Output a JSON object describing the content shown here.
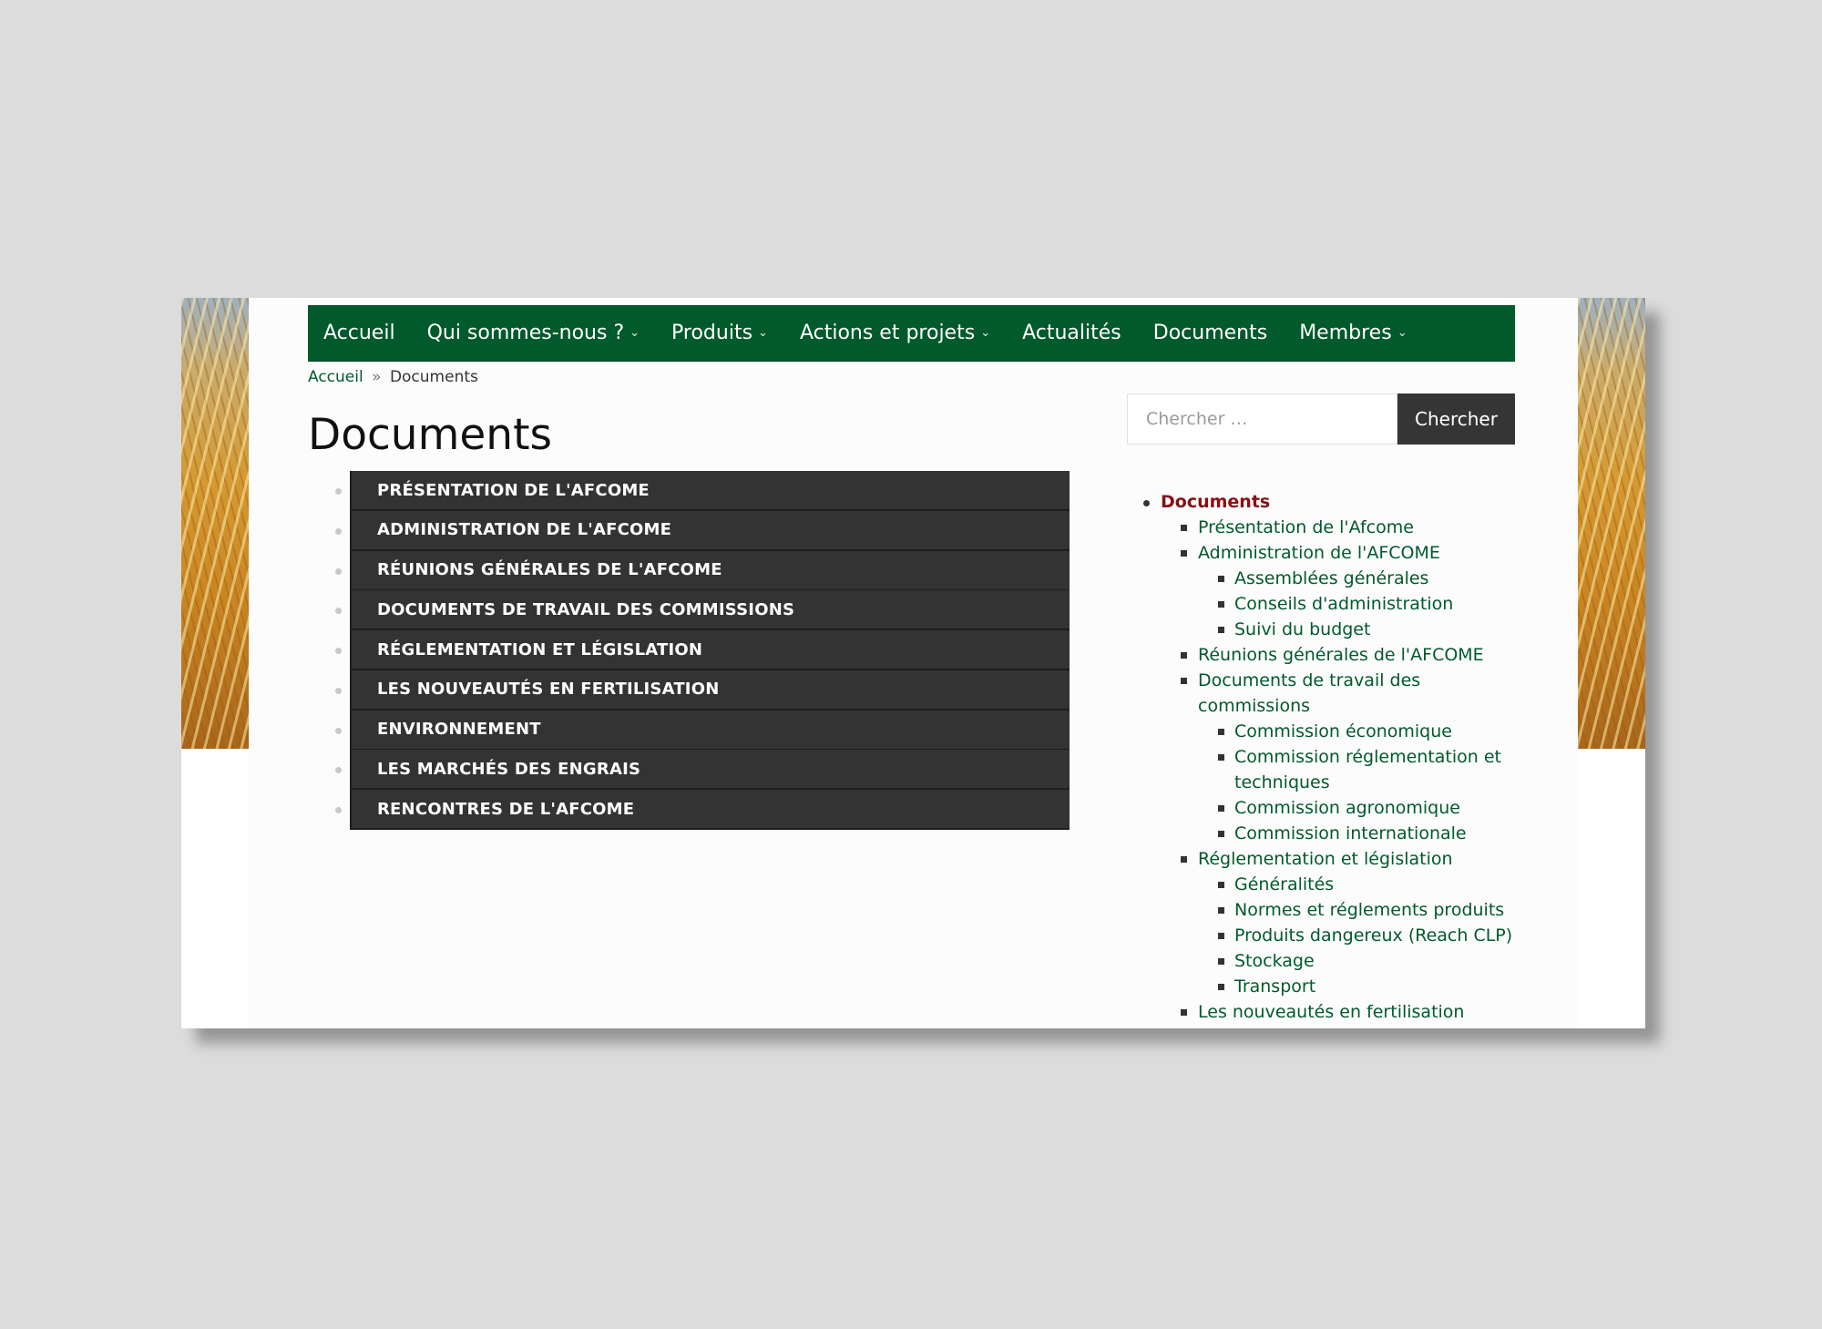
{
  "nav": {
    "items": [
      {
        "label": "Accueil",
        "has_submenu": false
      },
      {
        "label": "Qui sommes-nous ?",
        "has_submenu": true
      },
      {
        "label": "Produits",
        "has_submenu": true
      },
      {
        "label": "Actions et projets",
        "has_submenu": true
      },
      {
        "label": "Actualités",
        "has_submenu": false
      },
      {
        "label": "Documents",
        "has_submenu": false
      },
      {
        "label": "Membres",
        "has_submenu": true
      }
    ],
    "chevron": "⌄"
  },
  "breadcrumb": {
    "home": "Accueil",
    "separator": "»",
    "current": "Documents"
  },
  "page": {
    "title": "Documents"
  },
  "search": {
    "placeholder": "Chercher …",
    "value": "",
    "button_label": "Chercher"
  },
  "documents": [
    "PRÉSENTATION DE L'AFCOME",
    "ADMINISTRATION DE L'AFCOME",
    "RÉUNIONS GÉNÉRALES DE L'AFCOME",
    "DOCUMENTS DE TRAVAIL DES COMMISSIONS",
    "RÉGLEMENTATION ET LÉGISLATION",
    "LES NOUVEAUTÉS EN FERTILISATION",
    "ENVIRONNEMENT",
    "LES MARCHÉS DES ENGRAIS",
    "RENCONTRES DE L'AFCOME"
  ],
  "sidebar_tree": [
    {
      "label": "Documents",
      "level": 0,
      "current": true
    },
    {
      "label": "Présentation de l'Afcome",
      "level": 1
    },
    {
      "label": "Administration de l'AFCOME",
      "level": 1
    },
    {
      "label": "Assemblées générales",
      "level": 2
    },
    {
      "label": "Conseils d'administration",
      "level": 2
    },
    {
      "label": "Suivi du budget",
      "level": 2
    },
    {
      "label": "Réunions générales de l'AFCOME",
      "level": 1
    },
    {
      "label": "Documents de travail des commissions",
      "level": 1
    },
    {
      "label": "Commission économique",
      "level": 2
    },
    {
      "label": "Commission réglementation et techniques",
      "level": 2
    },
    {
      "label": "Commission agronomique",
      "level": 2
    },
    {
      "label": "Commission internationale",
      "level": 2
    },
    {
      "label": "Réglementation et législation",
      "level": 1
    },
    {
      "label": "Généralités",
      "level": 2
    },
    {
      "label": "Normes et réglements produits",
      "level": 2
    },
    {
      "label": "Produits dangereux (Reach CLP)",
      "level": 2
    },
    {
      "label": "Stockage",
      "level": 2
    },
    {
      "label": "Transport",
      "level": 2
    },
    {
      "label": "Les nouveautés en fertilisation",
      "level": 1
    }
  ],
  "colors": {
    "nav_bg": "#005a2b",
    "link": "#005a2b",
    "current_link": "#8b0d14",
    "doc_button_bg": "#333333"
  }
}
